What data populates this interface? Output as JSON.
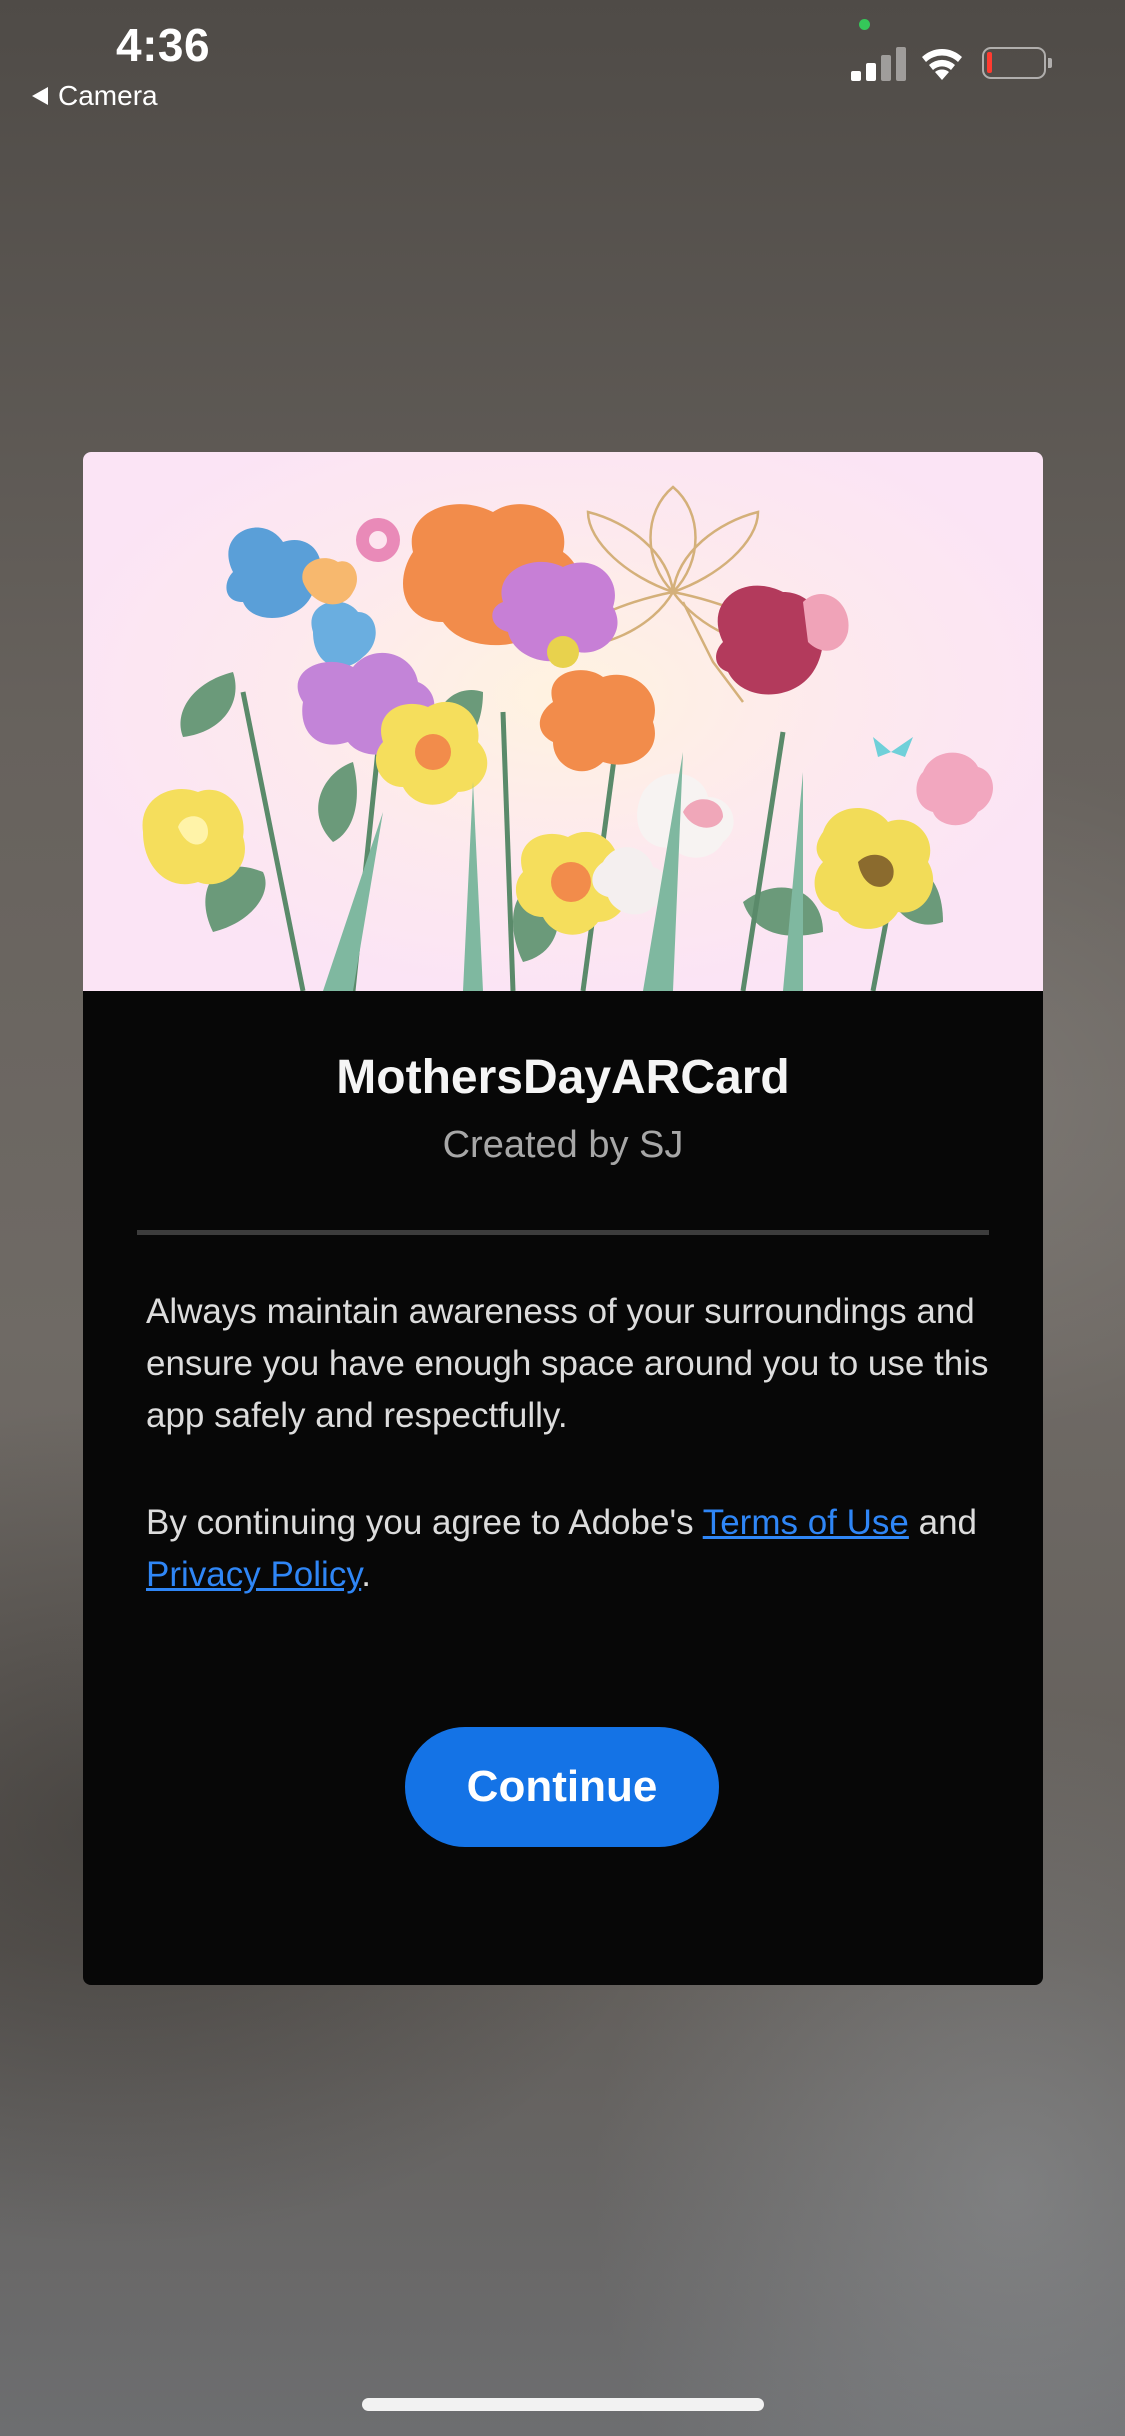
{
  "status_bar": {
    "time": "4:36",
    "back_label": "Camera",
    "battery_color": "#ff3b30",
    "camera_indicator_color": "#35c759"
  },
  "card": {
    "title": "MothersDayARCard",
    "subtitle": "Created by SJ",
    "safety_text": "Always maintain awareness of your surroundings and ensure you have enough space around you to use this app safely and respectfully.",
    "legal_prefix": "By continuing you agree to Adobe's ",
    "terms_link": "Terms of Use",
    "legal_and": " and ",
    "privacy_link": "Privacy Policy",
    "legal_suffix": ".",
    "continue_label": "Continue",
    "accent_color": "#1473e6",
    "link_color": "#2f86f6"
  }
}
